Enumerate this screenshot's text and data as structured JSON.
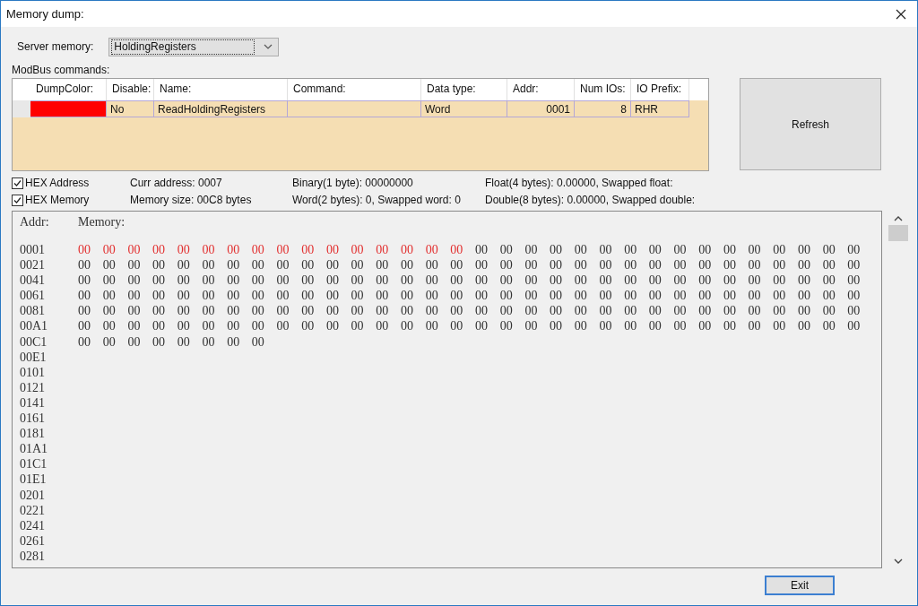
{
  "window": {
    "title": "Memory dump:"
  },
  "server_memory": {
    "label": "Server memory:",
    "value": "HoldingRegisters"
  },
  "commands": {
    "label": "ModBus commands:",
    "columns": [
      "DumpColor:",
      "Disable:",
      "Name:",
      "Command:",
      "Data type:",
      "Addr:",
      "Num IOs:",
      "IO Prefix:"
    ],
    "rows": [
      {
        "color": "#ff0000",
        "disable": "No",
        "name": "ReadHoldingRegisters",
        "command": "",
        "data_type": "Word",
        "addr": "0001",
        "num_ios": "8",
        "io_prefix": "RHR"
      }
    ]
  },
  "refresh_button": "Refresh",
  "options": [
    {
      "label": "HEX Address",
      "checked": true
    },
    {
      "label": "HEX Memory",
      "checked": true
    }
  ],
  "info": [
    [
      "Curr address: 0007",
      "Memory size: 00C8 bytes"
    ],
    [
      "Binary(1 byte): 00000000",
      "Word(2 bytes): 0, Swapped word: 0"
    ],
    [
      "Float(4 bytes): 0.00000, Swapped float:",
      "Double(8 bytes): 0.00000, Swapped double:"
    ]
  ],
  "memory": {
    "addr_header": "Addr:",
    "memory_header": "Memory:",
    "rows": [
      {
        "addr": "0001",
        "bytes": [
          {
            "v": "00",
            "marked": true
          },
          {
            "v": "00",
            "marked": true
          },
          {
            "v": "00",
            "marked": true
          },
          {
            "v": "00",
            "marked": true
          },
          {
            "v": "00",
            "marked": true
          },
          {
            "v": "00",
            "marked": true
          },
          {
            "v": "00",
            "marked": true
          },
          {
            "v": "00",
            "marked": true
          },
          {
            "v": "00",
            "marked": true
          },
          {
            "v": "00",
            "marked": true
          },
          {
            "v": "00",
            "marked": true
          },
          {
            "v": "00",
            "marked": true
          },
          {
            "v": "00",
            "marked": true
          },
          {
            "v": "00",
            "marked": true
          },
          {
            "v": "00",
            "marked": true
          },
          {
            "v": "00",
            "marked": true
          },
          {
            "v": "00",
            "marked": false
          },
          {
            "v": "00",
            "marked": false
          },
          {
            "v": "00",
            "marked": false
          },
          {
            "v": "00",
            "marked": false
          },
          {
            "v": "00",
            "marked": false
          },
          {
            "v": "00",
            "marked": false
          },
          {
            "v": "00",
            "marked": false
          },
          {
            "v": "00",
            "marked": false
          },
          {
            "v": "00",
            "marked": false
          },
          {
            "v": "00",
            "marked": false
          },
          {
            "v": "00",
            "marked": false
          },
          {
            "v": "00",
            "marked": false
          },
          {
            "v": "00",
            "marked": false
          },
          {
            "v": "00",
            "marked": false
          },
          {
            "v": "00",
            "marked": false
          },
          {
            "v": "00",
            "marked": false
          }
        ]
      },
      {
        "addr": "0021",
        "bytes": [
          {
            "v": "00",
            "marked": false
          },
          {
            "v": "00",
            "marked": false
          },
          {
            "v": "00",
            "marked": false
          },
          {
            "v": "00",
            "marked": false
          },
          {
            "v": "00",
            "marked": false
          },
          {
            "v": "00",
            "marked": false
          },
          {
            "v": "00",
            "marked": false
          },
          {
            "v": "00",
            "marked": false
          },
          {
            "v": "00",
            "marked": false
          },
          {
            "v": "00",
            "marked": false
          },
          {
            "v": "00",
            "marked": false
          },
          {
            "v": "00",
            "marked": false
          },
          {
            "v": "00",
            "marked": false
          },
          {
            "v": "00",
            "marked": false
          },
          {
            "v": "00",
            "marked": false
          },
          {
            "v": "00",
            "marked": false
          },
          {
            "v": "00",
            "marked": false
          },
          {
            "v": "00",
            "marked": false
          },
          {
            "v": "00",
            "marked": false
          },
          {
            "v": "00",
            "marked": false
          },
          {
            "v": "00",
            "marked": false
          },
          {
            "v": "00",
            "marked": false
          },
          {
            "v": "00",
            "marked": false
          },
          {
            "v": "00",
            "marked": false
          },
          {
            "v": "00",
            "marked": false
          },
          {
            "v": "00",
            "marked": false
          },
          {
            "v": "00",
            "marked": false
          },
          {
            "v": "00",
            "marked": false
          },
          {
            "v": "00",
            "marked": false
          },
          {
            "v": "00",
            "marked": false
          },
          {
            "v": "00",
            "marked": false
          },
          {
            "v": "00",
            "marked": false
          }
        ]
      },
      {
        "addr": "0041",
        "bytes": [
          {
            "v": "00",
            "marked": false
          },
          {
            "v": "00",
            "marked": false
          },
          {
            "v": "00",
            "marked": false
          },
          {
            "v": "00",
            "marked": false
          },
          {
            "v": "00",
            "marked": false
          },
          {
            "v": "00",
            "marked": false
          },
          {
            "v": "00",
            "marked": false
          },
          {
            "v": "00",
            "marked": false
          },
          {
            "v": "00",
            "marked": false
          },
          {
            "v": "00",
            "marked": false
          },
          {
            "v": "00",
            "marked": false
          },
          {
            "v": "00",
            "marked": false
          },
          {
            "v": "00",
            "marked": false
          },
          {
            "v": "00",
            "marked": false
          },
          {
            "v": "00",
            "marked": false
          },
          {
            "v": "00",
            "marked": false
          },
          {
            "v": "00",
            "marked": false
          },
          {
            "v": "00",
            "marked": false
          },
          {
            "v": "00",
            "marked": false
          },
          {
            "v": "00",
            "marked": false
          },
          {
            "v": "00",
            "marked": false
          },
          {
            "v": "00",
            "marked": false
          },
          {
            "v": "00",
            "marked": false
          },
          {
            "v": "00",
            "marked": false
          },
          {
            "v": "00",
            "marked": false
          },
          {
            "v": "00",
            "marked": false
          },
          {
            "v": "00",
            "marked": false
          },
          {
            "v": "00",
            "marked": false
          },
          {
            "v": "00",
            "marked": false
          },
          {
            "v": "00",
            "marked": false
          },
          {
            "v": "00",
            "marked": false
          },
          {
            "v": "00",
            "marked": false
          }
        ]
      },
      {
        "addr": "0061",
        "bytes": [
          {
            "v": "00",
            "marked": false
          },
          {
            "v": "00",
            "marked": false
          },
          {
            "v": "00",
            "marked": false
          },
          {
            "v": "00",
            "marked": false
          },
          {
            "v": "00",
            "marked": false
          },
          {
            "v": "00",
            "marked": false
          },
          {
            "v": "00",
            "marked": false
          },
          {
            "v": "00",
            "marked": false
          },
          {
            "v": "00",
            "marked": false
          },
          {
            "v": "00",
            "marked": false
          },
          {
            "v": "00",
            "marked": false
          },
          {
            "v": "00",
            "marked": false
          },
          {
            "v": "00",
            "marked": false
          },
          {
            "v": "00",
            "marked": false
          },
          {
            "v": "00",
            "marked": false
          },
          {
            "v": "00",
            "marked": false
          },
          {
            "v": "00",
            "marked": false
          },
          {
            "v": "00",
            "marked": false
          },
          {
            "v": "00",
            "marked": false
          },
          {
            "v": "00",
            "marked": false
          },
          {
            "v": "00",
            "marked": false
          },
          {
            "v": "00",
            "marked": false
          },
          {
            "v": "00",
            "marked": false
          },
          {
            "v": "00",
            "marked": false
          },
          {
            "v": "00",
            "marked": false
          },
          {
            "v": "00",
            "marked": false
          },
          {
            "v": "00",
            "marked": false
          },
          {
            "v": "00",
            "marked": false
          },
          {
            "v": "00",
            "marked": false
          },
          {
            "v": "00",
            "marked": false
          },
          {
            "v": "00",
            "marked": false
          },
          {
            "v": "00",
            "marked": false
          }
        ]
      },
      {
        "addr": "0081",
        "bytes": [
          {
            "v": "00",
            "marked": false
          },
          {
            "v": "00",
            "marked": false
          },
          {
            "v": "00",
            "marked": false
          },
          {
            "v": "00",
            "marked": false
          },
          {
            "v": "00",
            "marked": false
          },
          {
            "v": "00",
            "marked": false
          },
          {
            "v": "00",
            "marked": false
          },
          {
            "v": "00",
            "marked": false
          },
          {
            "v": "00",
            "marked": false
          },
          {
            "v": "00",
            "marked": false
          },
          {
            "v": "00",
            "marked": false
          },
          {
            "v": "00",
            "marked": false
          },
          {
            "v": "00",
            "marked": false
          },
          {
            "v": "00",
            "marked": false
          },
          {
            "v": "00",
            "marked": false
          },
          {
            "v": "00",
            "marked": false
          },
          {
            "v": "00",
            "marked": false
          },
          {
            "v": "00",
            "marked": false
          },
          {
            "v": "00",
            "marked": false
          },
          {
            "v": "00",
            "marked": false
          },
          {
            "v": "00",
            "marked": false
          },
          {
            "v": "00",
            "marked": false
          },
          {
            "v": "00",
            "marked": false
          },
          {
            "v": "00",
            "marked": false
          },
          {
            "v": "00",
            "marked": false
          },
          {
            "v": "00",
            "marked": false
          },
          {
            "v": "00",
            "marked": false
          },
          {
            "v": "00",
            "marked": false
          },
          {
            "v": "00",
            "marked": false
          },
          {
            "v": "00",
            "marked": false
          },
          {
            "v": "00",
            "marked": false
          },
          {
            "v": "00",
            "marked": false
          }
        ]
      },
      {
        "addr": "00A1",
        "bytes": [
          {
            "v": "00",
            "marked": false
          },
          {
            "v": "00",
            "marked": false
          },
          {
            "v": "00",
            "marked": false
          },
          {
            "v": "00",
            "marked": false
          },
          {
            "v": "00",
            "marked": false
          },
          {
            "v": "00",
            "marked": false
          },
          {
            "v": "00",
            "marked": false
          },
          {
            "v": "00",
            "marked": false
          },
          {
            "v": "00",
            "marked": false
          },
          {
            "v": "00",
            "marked": false
          },
          {
            "v": "00",
            "marked": false
          },
          {
            "v": "00",
            "marked": false
          },
          {
            "v": "00",
            "marked": false
          },
          {
            "v": "00",
            "marked": false
          },
          {
            "v": "00",
            "marked": false
          },
          {
            "v": "00",
            "marked": false
          },
          {
            "v": "00",
            "marked": false
          },
          {
            "v": "00",
            "marked": false
          },
          {
            "v": "00",
            "marked": false
          },
          {
            "v": "00",
            "marked": false
          },
          {
            "v": "00",
            "marked": false
          },
          {
            "v": "00",
            "marked": false
          },
          {
            "v": "00",
            "marked": false
          },
          {
            "v": "00",
            "marked": false
          },
          {
            "v": "00",
            "marked": false
          },
          {
            "v": "00",
            "marked": false
          },
          {
            "v": "00",
            "marked": false
          },
          {
            "v": "00",
            "marked": false
          },
          {
            "v": "00",
            "marked": false
          },
          {
            "v": "00",
            "marked": false
          },
          {
            "v": "00",
            "marked": false
          },
          {
            "v": "00",
            "marked": false
          }
        ]
      },
      {
        "addr": "00C1",
        "bytes": [
          {
            "v": "00",
            "marked": false
          },
          {
            "v": "00",
            "marked": false
          },
          {
            "v": "00",
            "marked": false
          },
          {
            "v": "00",
            "marked": false
          },
          {
            "v": "00",
            "marked": false
          },
          {
            "v": "00",
            "marked": false
          },
          {
            "v": "00",
            "marked": false
          },
          {
            "v": "00",
            "marked": false
          }
        ]
      },
      {
        "addr": "00E1"
      },
      {
        "addr": "0101"
      },
      {
        "addr": "0121"
      },
      {
        "addr": "0141"
      },
      {
        "addr": "0161"
      },
      {
        "addr": "0181"
      },
      {
        "addr": "01A1"
      },
      {
        "addr": "01C1"
      },
      {
        "addr": "01E1"
      },
      {
        "addr": "0201"
      },
      {
        "addr": "0221"
      },
      {
        "addr": "0241"
      },
      {
        "addr": "0261"
      },
      {
        "addr": "0281"
      }
    ]
  },
  "exit_button": "Exit"
}
